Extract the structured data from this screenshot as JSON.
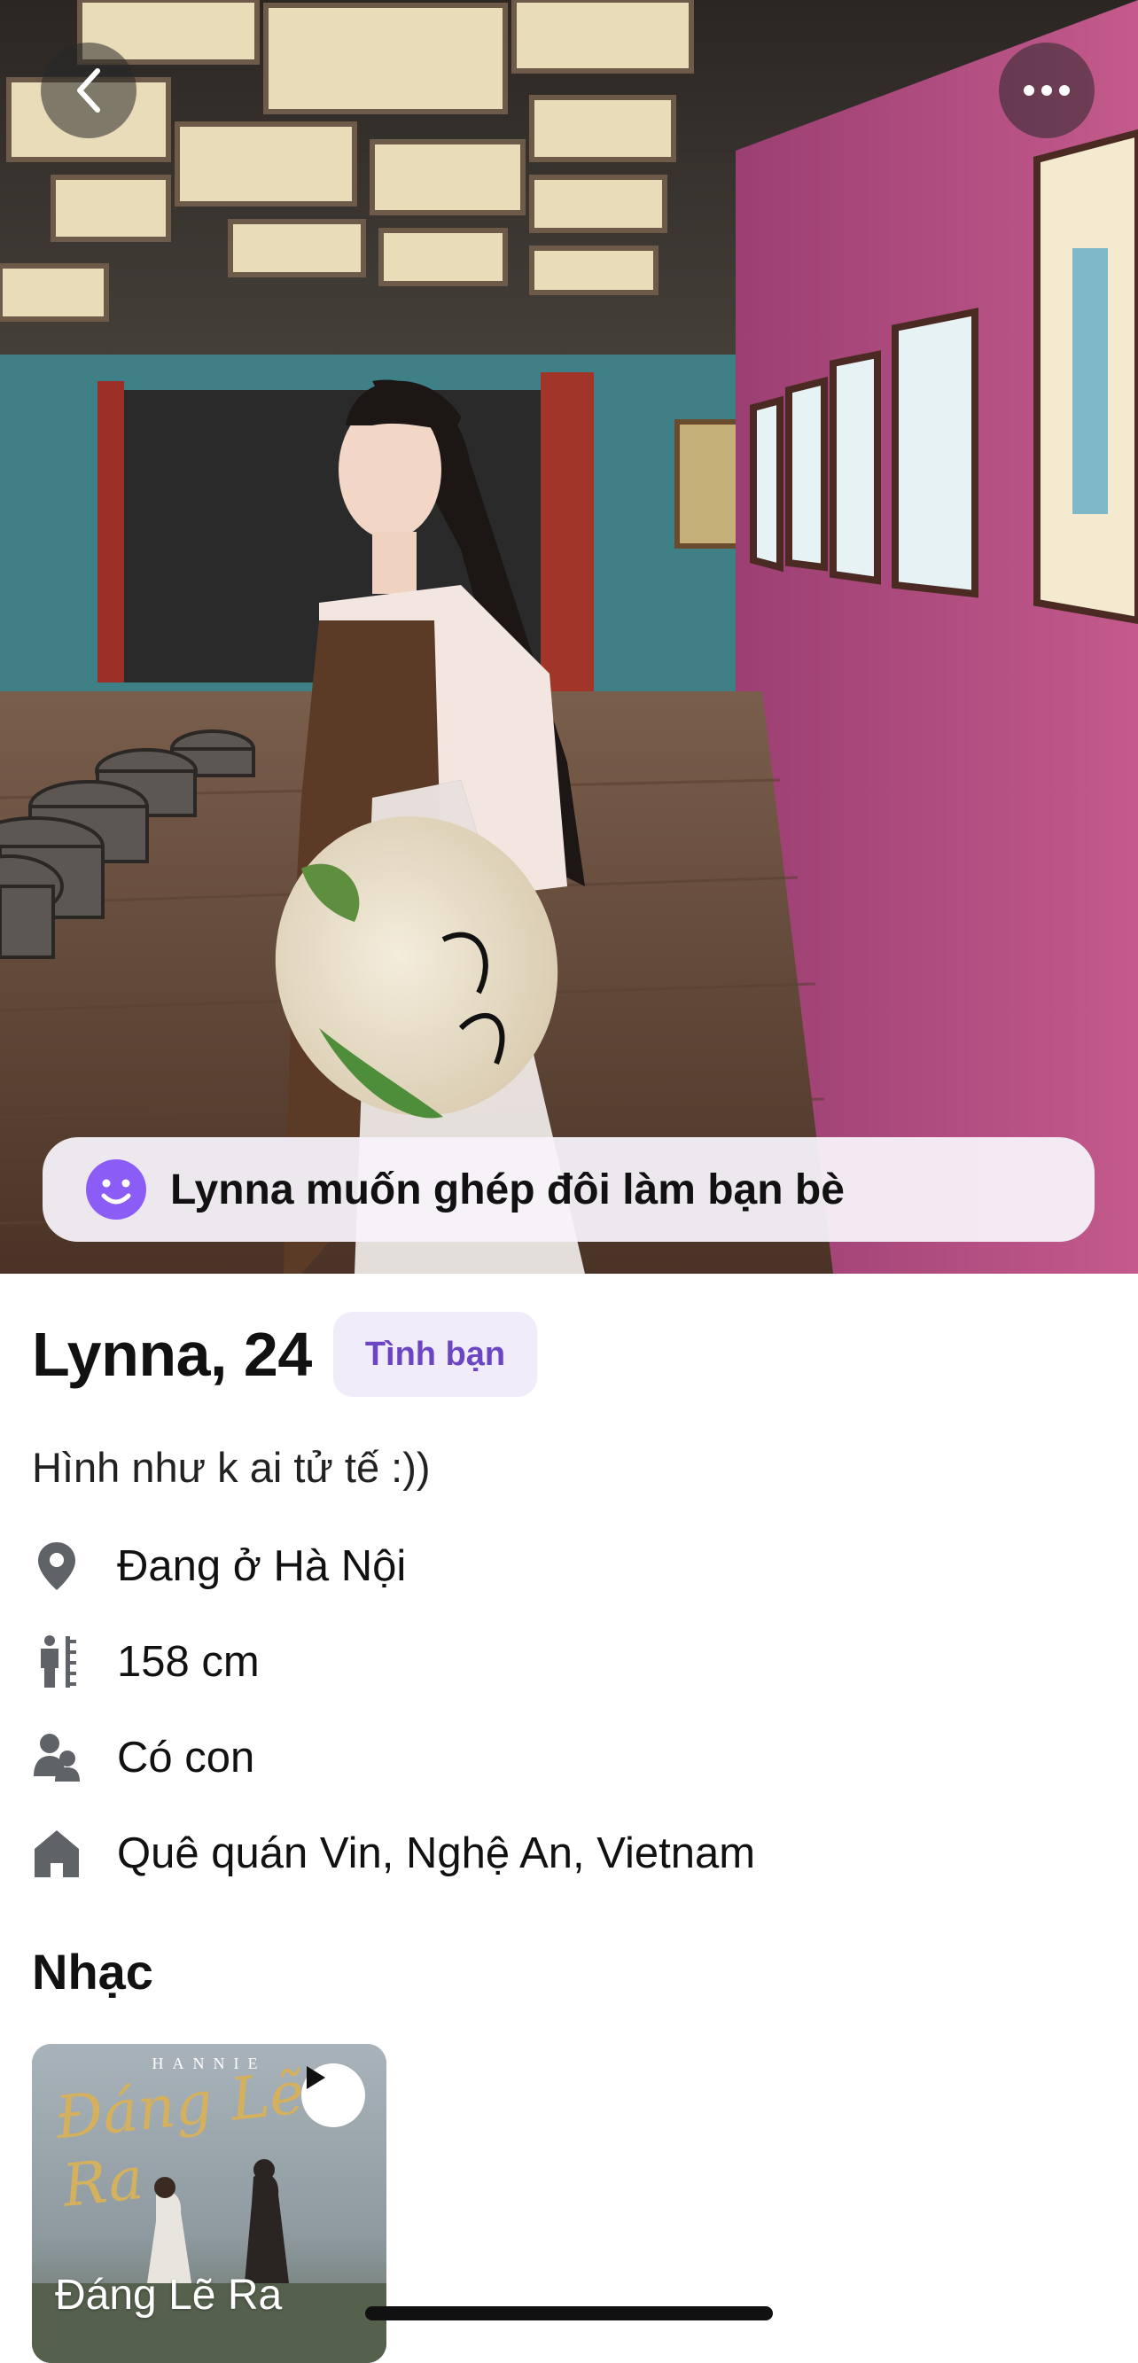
{
  "header": {
    "back_icon": "chevron-left-icon",
    "more_icon": "ellipsis-icon"
  },
  "banner": {
    "icon": "smiley-face-icon",
    "text": "Lynna muốn ghép đôi làm bạn bè",
    "accent": "#8b5cf6"
  },
  "profile": {
    "name_age": "Lynna, 24",
    "tag": "Tình bạn",
    "bio": "Hình như k ai tử tế :))",
    "details": [
      {
        "icon": "location-pin-icon",
        "label": "Đang ở Hà Nội"
      },
      {
        "icon": "height-icon",
        "label": "158 cm"
      },
      {
        "icon": "children-icon",
        "label": "Có con"
      },
      {
        "icon": "home-icon",
        "label": "Quê quán Vin, Nghệ An, Vietnam"
      }
    ]
  },
  "music": {
    "section_title": "Nhạc",
    "album_artist": "HANNIE",
    "album_script": "Đáng Lẽ Ra",
    "song_title": "Đáng Lẽ Ra",
    "play_icon": "play-icon"
  },
  "colors": {
    "tag_bg": "#f1ecfa",
    "tag_text": "#6a46c4",
    "icon_gray": "#5f6368"
  }
}
